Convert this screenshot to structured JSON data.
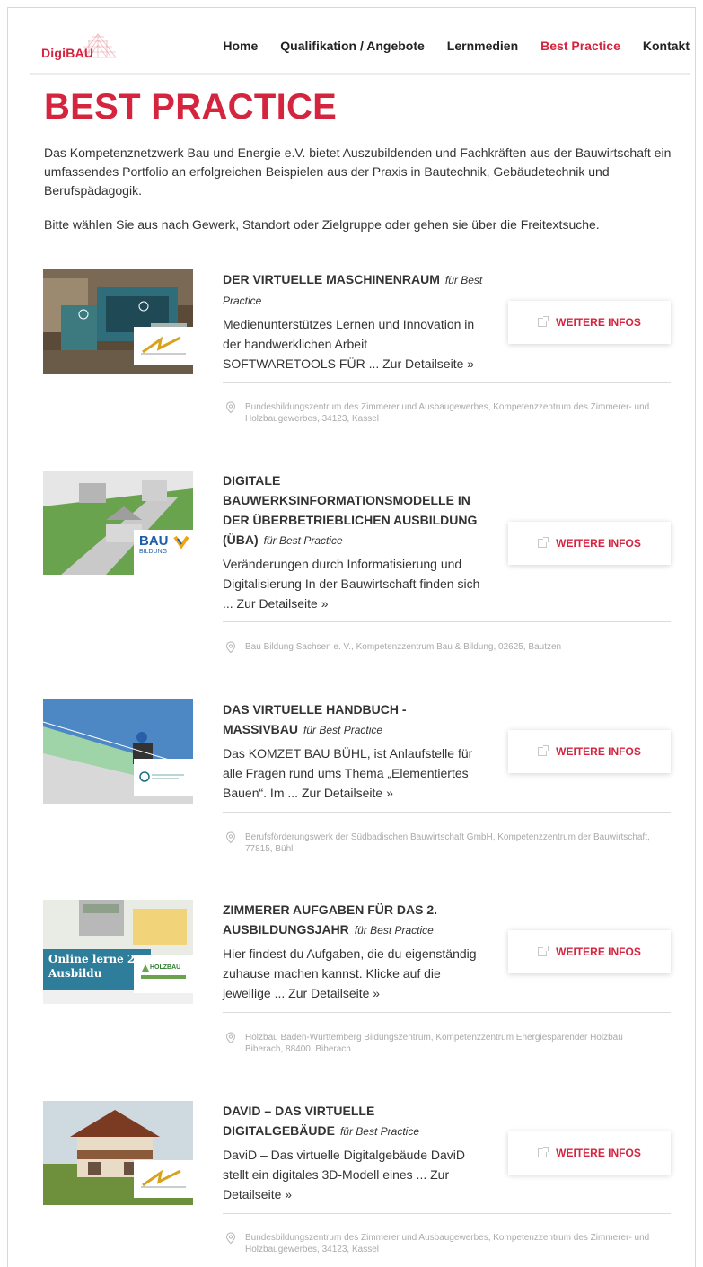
{
  "header": {
    "logo_text": "DigiBAU",
    "nav": [
      "Home",
      "Qualifikation / Angebote",
      "Lernmedien",
      "Best Practice",
      "Kontakt"
    ],
    "active_nav": "Best Practice"
  },
  "page": {
    "title": "BEST PRACTICE",
    "intro": "Das Kompetenznetzwerk Bau und Energie e.V. bietet Auszubildenden und Fachkräften aus der Bauwirtschaft ein umfassendes Portfolio an erfolgreichen Beispielen aus der Praxis in Bautechnik, Gebäudetechnik und Berufspädagogik.",
    "intro2": "Bitte wählen Sie aus nach Gewerk, Standort oder Zielgruppe oder gehen sie über die Freitextsuche."
  },
  "colors": {
    "accent": "#d4243e",
    "text": "#333333",
    "muted": "#aaaaaa"
  },
  "entries": [
    {
      "title": "DER VIRTUELLE MASCHINENRAUM",
      "fuer": "für Best Practice",
      "desc": "Medienunterstützes Lernen und Innovation in der handwerklichen Arbeit SOFTWARETOOLS FÜR ... Zur Detailseite »",
      "button": "WEITERE INFOS",
      "location": "Bundesbildungszentrum des Zimmerer und Ausbaugewerbes, Kompetenzzentrum des Zimmerer- und Holzbaugewerbes, 34123, Kassel"
    },
    {
      "title": "DIGITALE BAUWERKSINFORMATIONSMODELLE IN DER ÜBERBETRIEBLICHEN AUSBILDUNG (ÜBA)",
      "fuer": "für Best Practice",
      "desc": "Veränderungen durch Informatisierung und Digitalisierung In der Bauwirtschaft finden sich ... Zur Detailseite »",
      "button": "WEITERE INFOS",
      "location": "Bau Bildung Sachsen e. V., Kompetenzzentrum Bau & Bildung, 02625, Bautzen"
    },
    {
      "title": "DAS VIRTUELLE HANDBUCH - MASSIVBAU",
      "fuer": "für Best Practice",
      "desc": "Das KOMZET BAU BÜHL, ist Anlaufstelle für alle Fragen rund ums Thema „Elementiertes Bauen“. Im ... Zur Detailseite »",
      "button": "WEITERE INFOS",
      "location": "Berufsförderungswerk der Südbadischen Bauwirtschaft GmbH, Kompetenzzentrum der Bauwirtschaft, 77815, Bühl"
    },
    {
      "title": "ZIMMERER AUFGABEN FÜR DAS 2. AUSBILDUNGSJAHR",
      "fuer": "für Best Practice",
      "desc": "Hier findest du Aufgaben, die du eigenständig zuhause machen kannst. Klicke auf die jeweilige ... Zur Detailseite »",
      "button": "WEITERE INFOS",
      "location": "Holzbau Baden-Württemberg Bildungszentrum, Kompetenzzentrum Energiesparender Holzbau Biberach, 88400, Biberach"
    },
    {
      "title": "DAVID – DAS VIRTUELLE DIGITALGEBÄUDE",
      "fuer": "für Best Practice",
      "desc": "DaviD – Das virtuelle Digitalgebäude  DaviD stellt ein digitales 3D-Modell eines ... Zur Detailseite »",
      "button": "WEITERE INFOS",
      "location": "Bundesbildungszentrum des Zimmerer und Ausbaugewerbes, Kompetenzzentrum des Zimmerer- und Holzbaugewerbes, 34123, Kassel"
    }
  ],
  "thumbnail_texts": {
    "entry2_badge": "BAU",
    "entry2_badge_sub": "BILDUNG",
    "entry4_overlay": "Online lerne 2. Ausbildu",
    "entry4_badge": "HOLZBAU"
  }
}
